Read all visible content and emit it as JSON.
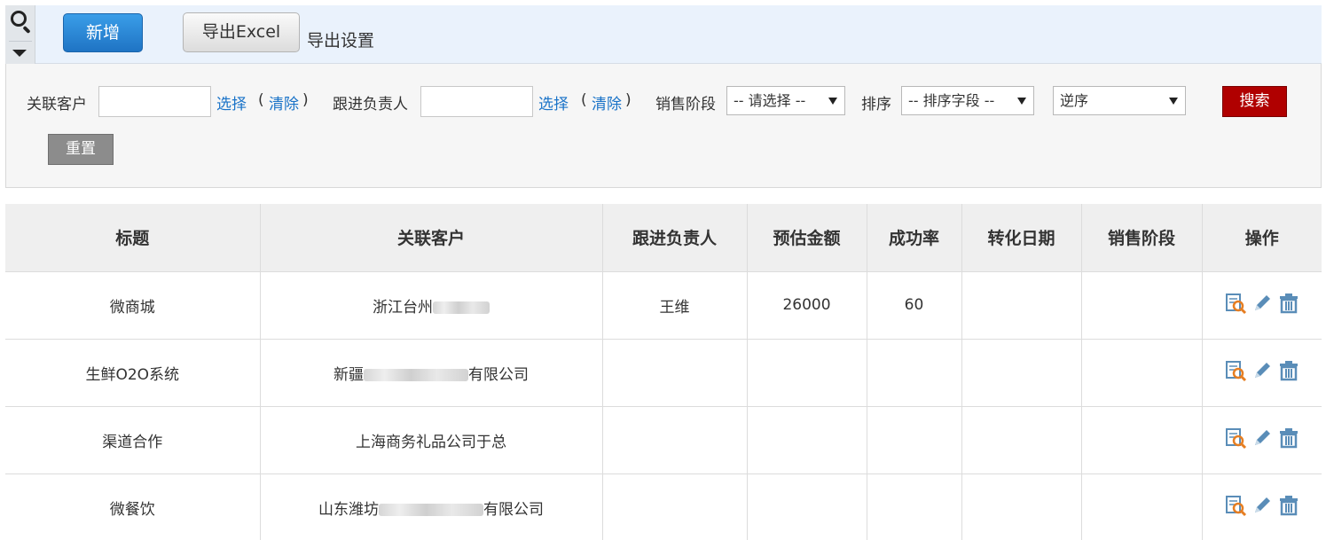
{
  "toolbar": {
    "add_label": "新增",
    "export_label": "导出Excel",
    "export_settings_label": "导出设置"
  },
  "filters": {
    "customer_label": "关联客户",
    "customer_select": "选择",
    "customer_clear": "清除",
    "owner_label": "跟进负责人",
    "owner_select": "选择",
    "owner_clear": "清除",
    "stage_label": "销售阶段",
    "stage_value": "-- 请选择 --",
    "sort_label": "排序",
    "sort_field_value": "-- 排序字段 --",
    "sort_order_value": "逆序",
    "search_label": "搜索",
    "reset_label": "重置"
  },
  "table": {
    "columns": [
      "标题",
      "关联客户",
      "跟进负责人",
      "预估金额",
      "成功率",
      "转化日期",
      "销售阶段",
      "操作"
    ],
    "rows": [
      {
        "title": "微商城",
        "customer_prefix": "浙江台州",
        "customer_suffix": "",
        "owner": "王维",
        "amount": "26000",
        "rate": "60",
        "date": "",
        "stage": ""
      },
      {
        "title": "生鲜O2O系统",
        "customer_prefix": "新疆",
        "customer_suffix": "有限公司",
        "owner": "",
        "amount": "",
        "rate": "",
        "date": "",
        "stage": ""
      },
      {
        "title": "渠道合作",
        "customer_prefix": "上海商务礼品公司于总",
        "customer_suffix": "",
        "owner": "",
        "amount": "",
        "rate": "",
        "date": "",
        "stage": ""
      },
      {
        "title": "微餐饮",
        "customer_prefix": "山东潍坊",
        "customer_suffix": "有限公司",
        "owner": "",
        "amount": "",
        "rate": "",
        "date": "",
        "stage": ""
      }
    ]
  },
  "icons": {
    "view": "view-detail-icon",
    "edit": "edit-pencil-icon",
    "delete": "trash-icon"
  },
  "colors": {
    "primary_button": "#1f74c4",
    "search_button": "#b00000",
    "link": "#1a73c8",
    "icon": "#5a8db8"
  }
}
